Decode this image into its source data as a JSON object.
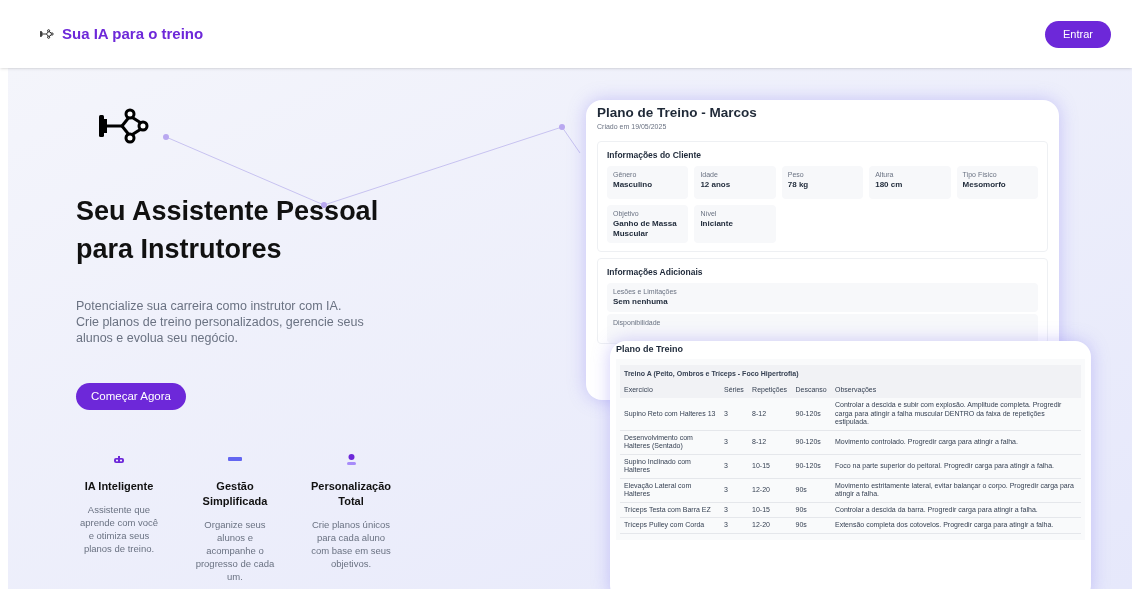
{
  "header": {
    "brand": "Sua IA para o treino",
    "login_button": "Entrar"
  },
  "hero": {
    "title": "Seu Assistente Pessoal para Instrutores",
    "description": "Potencialize sua carreira como instrutor com IA. Crie planos de treino personalizados, gerencie seus alunos e evolua seu negócio.",
    "cta": "Começar Agora"
  },
  "features": [
    {
      "kind": "robot",
      "title": "IA Inteligente",
      "text": "Assistente que aprende com você e otimiza seus planos de treino."
    },
    {
      "kind": "bar",
      "title": "Gestão Simplificada",
      "text": "Organize seus alunos e acompanhe o progresso de cada um."
    },
    {
      "kind": "person",
      "title": "Personalização Total",
      "text": "Crie planos únicos para cada aluno com base em seus objetivos."
    }
  ],
  "plan_card": {
    "title": "Plano de Treino - Marcos",
    "created": "Criado em 19/05/2025",
    "client_info": {
      "title": "Informações do Cliente",
      "fields": [
        {
          "label": "Gênero",
          "value": "Masculino"
        },
        {
          "label": "Idade",
          "value": "12 anos"
        },
        {
          "label": "Peso",
          "value": "78 kg"
        },
        {
          "label": "Altura",
          "value": "180 cm"
        },
        {
          "label": "Tipo Físico",
          "value": "Mesomorfo"
        },
        {
          "label": "Objetivo",
          "value": "Ganho de Massa Muscular"
        },
        {
          "label": "Nível",
          "value": "Iniciante"
        }
      ]
    },
    "additional_info": {
      "title": "Informações Adicionais",
      "fields": [
        {
          "label": "Lesões e Limitações",
          "value": "Sem nenhuma"
        },
        {
          "label": "Disponibilidade"
        }
      ]
    }
  },
  "workout_card": {
    "title": "Plano de Treino",
    "section": "Treino A (Peito, Ombros e Tríceps - Foco Hipertrofia)",
    "columns": [
      "Exercício",
      "Séries",
      "Repetições",
      "Descanso",
      "Observações"
    ],
    "rows": [
      [
        "Supino Reto com Halteres 13",
        "3",
        "8-12",
        "90-120s",
        "Controlar a descida e subir com explosão. Amplitude completa. Progredir carga para atingir a falha muscular DENTRO da faixa de repetições estipulada."
      ],
      [
        "Desenvolvimento com Halteres (Sentado)",
        "3",
        "8-12",
        "90-120s",
        "Movimento controlado. Progredir carga para atingir a falha."
      ],
      [
        "Supino Inclinado com Halteres",
        "3",
        "10-15",
        "90-120s",
        "Foco na parte superior do peitoral. Progredir carga para atingir a falha."
      ],
      [
        "Elevação Lateral com Halteres",
        "3",
        "12-20",
        "90s",
        "Movimento estritamente lateral, evitar balançar o corpo. Progredir carga para atingir a falha."
      ],
      [
        "Tríceps Testa com Barra EZ",
        "3",
        "10-15",
        "90s",
        "Controlar a descida da barra. Progredir carga para atingir a falha."
      ],
      [
        "Tríceps Pulley com Corda",
        "3",
        "12-20",
        "90s",
        "Extensão completa dos cotovelos. Progredir carga para atingir a falha."
      ]
    ]
  }
}
